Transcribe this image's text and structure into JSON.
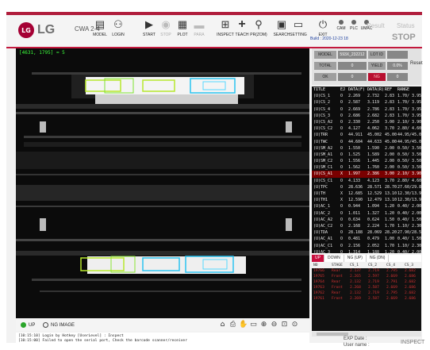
{
  "app": {
    "model_name": "CWA 2-4",
    "logo_text": "LG",
    "build": "Build : 2020-12-23 18"
  },
  "toolbar": {
    "buttons": [
      {
        "label": "MODEL"
      },
      {
        "label": "LOGIN"
      },
      {
        "label": "START"
      },
      {
        "label": "STOP"
      },
      {
        "label": "PLOT"
      },
      {
        "label": "PARA"
      },
      {
        "label": "INSPECT"
      },
      {
        "label": "TEACH"
      },
      {
        "label": "PR(ZOM)"
      },
      {
        "label": "SEARCH"
      },
      {
        "label": "SETTING"
      },
      {
        "label": "EXIT"
      }
    ],
    "lamps": [
      {
        "label": "CAM"
      },
      {
        "label": "PLC"
      },
      {
        "label": "UMAC"
      }
    ],
    "result_label": "Result",
    "status_label": "Status",
    "status_value": "STOP"
  },
  "viewer": {
    "coordinate_readout": "[4631, 1795] = 5"
  },
  "viewbar": {
    "radio_up": "UP",
    "radio_ng": "NG IMAGE"
  },
  "log": {
    "line1": "[10:15:10] Login by Hotkey [UserLevel] : Inspect",
    "line2": "[10:15:00] Failed to open the serial port, Check the barcode scanner/receiver"
  },
  "summary": {
    "model_label": "MODEL",
    "model_value": "593X_232212",
    "lot_label": "LOT ID",
    "lot_value": "",
    "total_label": "TOTAL",
    "total_value": "0",
    "yield_label": "YIELD",
    "yield_value": "0.0%",
    "ok_label": "OK",
    "ok_value": "0",
    "ng_label": "NG",
    "ng_value": "0",
    "reset_label": "Reset"
  },
  "table1": {
    "headers": [
      "TITLE",
      "EJ",
      "DATA(F)",
      "DATA(R)",
      "REF",
      "RANGE"
    ],
    "rows": [
      [
        "(U)CS_1",
        "O",
        "2.269",
        "2.732",
        "2.83",
        "1.70/ 3.95"
      ],
      [
        "(U)CS_2",
        "O",
        "2.587",
        "3.119",
        "2.83",
        "1.70/ 3.95"
      ],
      [
        "(U)CS_4",
        "O",
        "2.669",
        "2.786",
        "2.83",
        "1.70/ 3.95"
      ],
      [
        "(U)CS_3",
        "O",
        "2.686",
        "2.682",
        "2.83",
        "1.70/ 3.95"
      ],
      [
        "(U)CS_A2",
        "O",
        "2.330",
        "2.250",
        "3.00",
        "2.10/ 3.90"
      ],
      [
        "(U)CS_C2",
        "O",
        "4.127",
        "4.062",
        "3.70",
        "2.80/ 4.60"
      ],
      [
        "(U)TRR",
        "O",
        "44.911",
        "45.002",
        "45.00",
        "44.95/45.05"
      ],
      [
        "(U)TWC",
        "O",
        "44.604",
        "44.633",
        "45.00",
        "44.95/45.05"
      ],
      [
        "(U)SM_A2",
        "O",
        "1.550",
        "1.590",
        "2.00",
        "0.50/ 3.50"
      ],
      [
        "(U)SM_A1",
        "O",
        "1.525",
        "1.589",
        "2.00",
        "0.50/ 3.50"
      ],
      [
        "(U)SM_C2",
        "O",
        "1.556",
        "1.445",
        "2.00",
        "0.50/ 3.50"
      ],
      [
        "(U)SM_C1",
        "O",
        "1.562",
        "1.760",
        "2.00",
        "0.50/ 3.50"
      ],
      [
        "(U)CS_A1",
        "X",
        "1.997",
        "2.386",
        "3.00",
        "2.10/ 3.90"
      ],
      [
        "(U)CS_C1",
        "O",
        "4.133",
        "4.123",
        "3.70",
        "2.80/ 4.60"
      ],
      [
        "(U)TPC",
        "O",
        "28.636",
        "28.571",
        "28.70",
        "27.60/29.80"
      ],
      [
        "(U)TH",
        "X",
        "12.685",
        "12.529",
        "13.10",
        "12.30/13.90"
      ],
      [
        "(U)TH1",
        "X",
        "12.590",
        "12.479",
        "13.10",
        "12.30/13.90"
      ],
      [
        "(U)AC_1",
        "O",
        "0.944",
        "1.094",
        "1.20",
        "0.40/ 2.00"
      ],
      [
        "(U)AC_2",
        "O",
        "1.011",
        "1.327",
        "1.20",
        "0.40/ 2.00"
      ],
      [
        "(U)AC_A2",
        "O",
        "0.634",
        "0.624",
        "1.50",
        "0.40/ 1.50"
      ],
      [
        "(U)AC_C2",
        "O",
        "2.168",
        "2.224",
        "1.70",
        "1.10/ 2.30"
      ],
      [
        "(U)TDA",
        "O",
        "28.188",
        "28.069",
        "28.20",
        "27.90/28.50"
      ],
      [
        "(U)AC_A1",
        "O",
        "0.481",
        "0.479",
        "1.00",
        "0.40/ 1.50"
      ],
      [
        "(U)AC_C1",
        "O",
        "2.156",
        "2.052",
        "1.70",
        "1.10/ 2.30"
      ],
      [
        "(U)AC_3",
        "O",
        "1.314",
        "1.188",
        "1.20",
        "0.40/ 2.00"
      ],
      [
        "(U)AC_4",
        "O",
        "1.402",
        "1.278",
        "1.20",
        "0.40/ 2.00"
      ]
    ]
  },
  "tabs": [
    {
      "label": "UP"
    },
    {
      "label": "DOWN"
    },
    {
      "label": "NG (UP)"
    },
    {
      "label": "NG (DN)"
    }
  ],
  "table2": {
    "headers": [
      "NO",
      "STAGE",
      "CS_1",
      "CS_2",
      "CS_4",
      "CS_3"
    ],
    "rows": [
      [
        "19766",
        "Rear",
        "2.137",
        "2.719",
        "2.795",
        "2.682"
      ],
      [
        "19765",
        "Front",
        "2.265",
        "2.597",
        "2.669",
        "2.686"
      ],
      [
        "19764",
        "Rear",
        "2.132",
        "2.719",
        "2.791",
        "2.682"
      ],
      [
        "19763",
        "Front",
        "2.268",
        "2.587",
        "2.669",
        "2.686"
      ],
      [
        "19762",
        "Rear",
        "2.132",
        "2.719",
        "2.795",
        "2.682"
      ],
      [
        "19761",
        "Front",
        "2.269",
        "2.587",
        "2.669",
        "2.686"
      ]
    ]
  },
  "info": {
    "exp_label": "EXP Date :",
    "user_label": "User name :",
    "mode": "INSPECT"
  }
}
